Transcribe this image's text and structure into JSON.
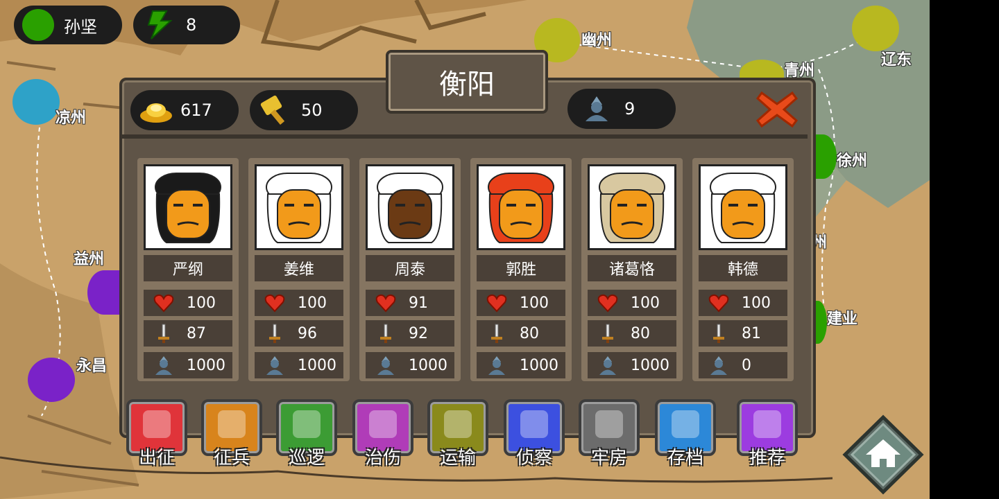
{
  "player": {
    "name": "孙坚",
    "color": "#2aa000",
    "energy": "8"
  },
  "map": {
    "regions": [
      {
        "name": "幽州"
      },
      {
        "name": "青州"
      },
      {
        "name": "辽东"
      },
      {
        "name": "凉州"
      },
      {
        "name": "徐州"
      },
      {
        "name": "益州"
      },
      {
        "name": "建业"
      },
      {
        "name": "永昌"
      },
      {
        "name": "州"
      }
    ],
    "faction_colors": {
      "green": "#2aa000",
      "yellow": "#b8b820",
      "blue": "#2ea2c8",
      "purple": "#7a22c8"
    }
  },
  "city": {
    "title": "衡阳",
    "gold": "617",
    "supplies": "50",
    "troops": "9",
    "close_icon": "close-x-icon"
  },
  "generals": [
    {
      "name": "严纲",
      "hp": "100",
      "attack": "87",
      "soldiers": "1000",
      "skin": "#f29a1a",
      "hair": "#1a1a1a"
    },
    {
      "name": "姜维",
      "hp": "100",
      "attack": "96",
      "soldiers": "1000",
      "skin": "#f29a1a",
      "hair": "#ffffff"
    },
    {
      "name": "周泰",
      "hp": "91",
      "attack": "92",
      "soldiers": "1000",
      "skin": "#6b3a14",
      "hair": "#ffffff"
    },
    {
      "name": "郭胜",
      "hp": "100",
      "attack": "80",
      "soldiers": "1000",
      "skin": "#f29a1a",
      "hair": "#e8401a"
    },
    {
      "name": "诸葛恪",
      "hp": "100",
      "attack": "80",
      "soldiers": "1000",
      "skin": "#f29a1a",
      "hair": "#d8c8a0"
    },
    {
      "name": "韩德",
      "hp": "100",
      "attack": "81",
      "soldiers": "0",
      "skin": "#f29a1a",
      "hair": "#ffffff"
    }
  ],
  "actions": [
    {
      "label": "出征",
      "icon": "spear-icon",
      "color": "#e0343a"
    },
    {
      "label": "征兵",
      "icon": "scroll-icon",
      "color": "#d8841c"
    },
    {
      "label": "巡逻",
      "icon": "horse-icon",
      "color": "#3c9c34"
    },
    {
      "label": "治伤",
      "icon": "meat-icon",
      "color": "#b03cb8"
    },
    {
      "label": "运输",
      "icon": "cart-icon",
      "color": "#8a8a1c"
    },
    {
      "label": "侦察",
      "icon": "radar-icon",
      "color": "#3c50e0"
    },
    {
      "label": "牢房",
      "icon": "jail-icon",
      "color": "#6c6c6c"
    },
    {
      "label": "存档",
      "icon": "book-icon",
      "color": "#2c88d8"
    },
    {
      "label": "推荐",
      "icon": "more-icon",
      "color": "#9c3ce0"
    }
  ],
  "home_icon": "home-icon"
}
